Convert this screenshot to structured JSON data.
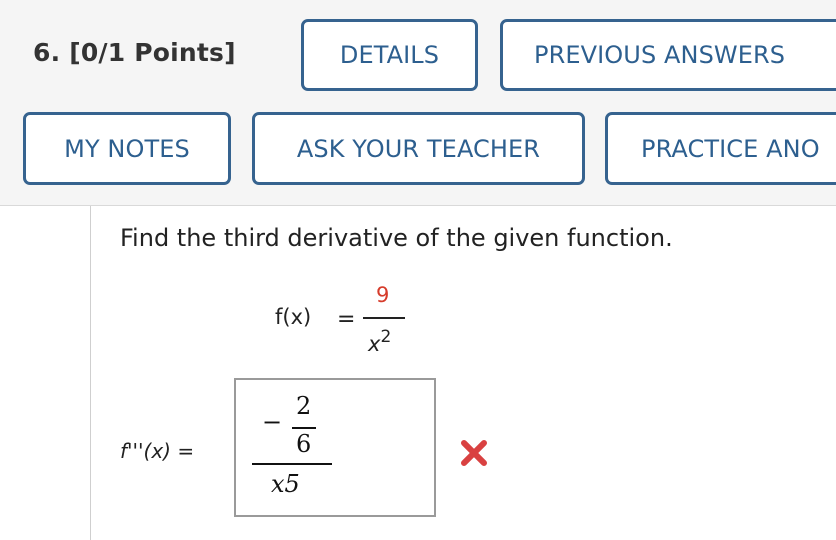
{
  "header": {
    "question_title": "6.  [0/1 Points]",
    "buttons": {
      "details": "DETAILS",
      "previous_answers": "PREVIOUS ANSWERS",
      "my_notes": "MY NOTES",
      "ask_teacher": "ASK YOUR TEACHER",
      "practice_another": "PRACTICE ANO"
    }
  },
  "question": {
    "prompt": "Find the third derivative of the given function.",
    "function": {
      "label": "f(x)",
      "equals": "=",
      "numerator": "9",
      "denominator_base": "x",
      "denominator_exponent": "2"
    }
  },
  "answer": {
    "label": "f'''(x)",
    "equals": "=",
    "submitted": {
      "minus": "−",
      "inner_numerator": "2",
      "inner_denominator": "6",
      "outer_denominator": "x5"
    },
    "status_icon": "incorrect-x-icon"
  },
  "colors": {
    "button_border": "#36638f",
    "button_text": "#2d5f8f",
    "highlight_number": "#d63b2a",
    "incorrect_mark": "#d94141",
    "header_bg": "#f5f5f5"
  }
}
